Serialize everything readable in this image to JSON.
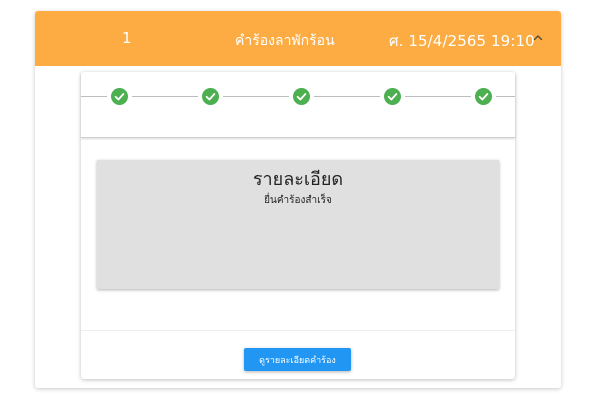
{
  "request": {
    "number": "1",
    "title": "คำร้องลาพักร้อน",
    "datetime": "ศ. 15/4/2565 19:10",
    "expand_icon": "chevron-up-icon"
  },
  "stepper": {
    "steps": [
      {
        "status": "complete",
        "icon": "check-circle-icon"
      },
      {
        "status": "complete",
        "icon": "check-circle-icon"
      },
      {
        "status": "complete",
        "icon": "check-circle-icon"
      },
      {
        "status": "complete",
        "icon": "check-circle-icon"
      },
      {
        "status": "complete",
        "icon": "check-circle-icon"
      }
    ],
    "complete_color": "#4caf50"
  },
  "details": {
    "heading": "รายละเอียด",
    "status_text": "ยื่นคำร้องสำเร็จ"
  },
  "actions": {
    "view_details_label": "ดูรายละเอียดคำร้อง"
  },
  "colors": {
    "header": "#fcac43",
    "button": "#2196f3",
    "detail_box": "#e0e0e0"
  }
}
